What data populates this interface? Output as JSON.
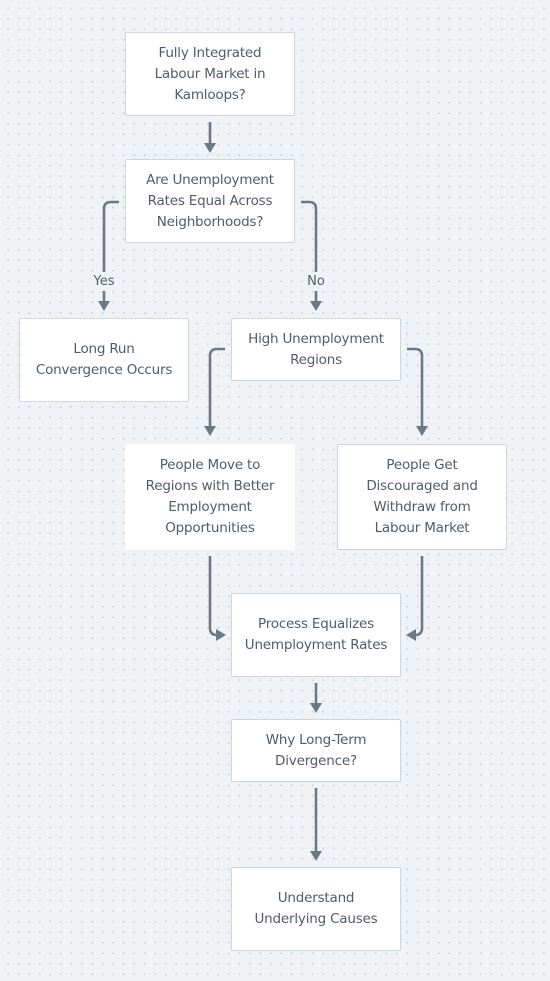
{
  "diagram": {
    "type": "flowchart",
    "nodes": [
      {
        "id": "n1",
        "label": "Fully Integrated\nLabour Market in\nKamloops?"
      },
      {
        "id": "n2",
        "label": "Are Unemployment\nRates Equal Across\nNeighborhoods?"
      },
      {
        "id": "n3",
        "label": "Long Run\nConvergence Occurs"
      },
      {
        "id": "n4",
        "label": "High Unemployment\nRegions"
      },
      {
        "id": "n5",
        "label": "People Move to\nRegions with Better\nEmployment\nOpportunities"
      },
      {
        "id": "n6",
        "label": "People Get\nDiscouraged and\nWithdraw from\nLabour Market"
      },
      {
        "id": "n7",
        "label": "Process Equalizes\nUnemployment Rates"
      },
      {
        "id": "n8",
        "label": "Why Long-Term\nDivergence?"
      },
      {
        "id": "n9",
        "label": "Understand\nUnderlying Causes"
      }
    ],
    "edges": [
      {
        "from": "n1",
        "to": "n2",
        "label": ""
      },
      {
        "from": "n2",
        "to": "n3",
        "label": "Yes"
      },
      {
        "from": "n2",
        "to": "n4",
        "label": "No"
      },
      {
        "from": "n4",
        "to": "n5",
        "label": ""
      },
      {
        "from": "n4",
        "to": "n6",
        "label": ""
      },
      {
        "from": "n5",
        "to": "n7",
        "label": ""
      },
      {
        "from": "n6",
        "to": "n7",
        "label": ""
      },
      {
        "from": "n7",
        "to": "n8",
        "label": ""
      },
      {
        "from": "n8",
        "to": "n9",
        "label": ""
      }
    ],
    "colors": {
      "background": "#f0f3f6",
      "node_fill": "#ffffff",
      "node_border": "#cdd6df",
      "edge": "#6b7886",
      "text": "#525c68"
    }
  }
}
